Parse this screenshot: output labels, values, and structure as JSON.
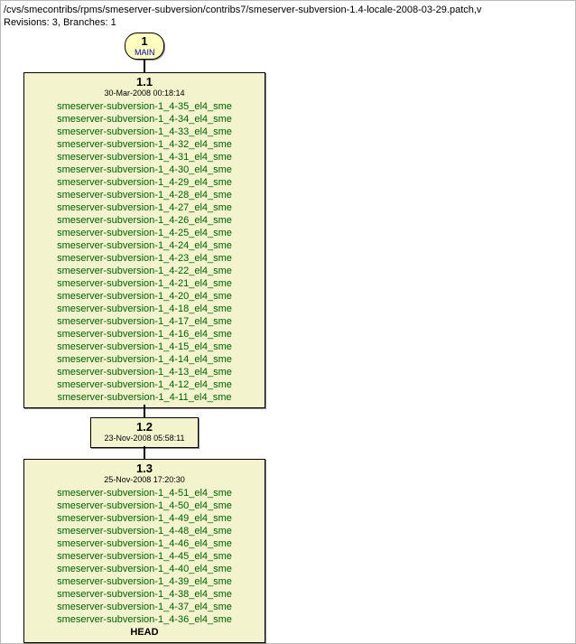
{
  "header": {
    "path": "/cvs/smecontribs/rpms/smeserver-subversion/contribs7/smeserver-subversion-1.4-locale-2008-03-29.patch,v",
    "meta": "Revisions: 3, Branches: 1"
  },
  "branch": {
    "num": "1",
    "name": "MAIN"
  },
  "nodes": [
    {
      "version": "1.1",
      "date": "30-Mar-2008 00:18:14",
      "tags": [
        "smeserver-subversion-1_4-35_el4_sme",
        "smeserver-subversion-1_4-34_el4_sme",
        "smeserver-subversion-1_4-33_el4_sme",
        "smeserver-subversion-1_4-32_el4_sme",
        "smeserver-subversion-1_4-31_el4_sme",
        "smeserver-subversion-1_4-30_el4_sme",
        "smeserver-subversion-1_4-29_el4_sme",
        "smeserver-subversion-1_4-28_el4_sme",
        "smeserver-subversion-1_4-27_el4_sme",
        "smeserver-subversion-1_4-26_el4_sme",
        "smeserver-subversion-1_4-25_el4_sme",
        "smeserver-subversion-1_4-24_el4_sme",
        "smeserver-subversion-1_4-23_el4_sme",
        "smeserver-subversion-1_4-22_el4_sme",
        "smeserver-subversion-1_4-21_el4_sme",
        "smeserver-subversion-1_4-20_el4_sme",
        "smeserver-subversion-1_4-18_el4_sme",
        "smeserver-subversion-1_4-17_el4_sme",
        "smeserver-subversion-1_4-16_el4_sme",
        "smeserver-subversion-1_4-15_el4_sme",
        "smeserver-subversion-1_4-14_el4_sme",
        "smeserver-subversion-1_4-13_el4_sme",
        "smeserver-subversion-1_4-12_el4_sme",
        "smeserver-subversion-1_4-11_el4_sme"
      ],
      "head": ""
    },
    {
      "version": "1.2",
      "date": "23-Nov-2008 05:58:11",
      "tags": [],
      "head": ""
    },
    {
      "version": "1.3",
      "date": "25-Nov-2008 17:20:30",
      "tags": [
        "smeserver-subversion-1_4-51_el4_sme",
        "smeserver-subversion-1_4-50_el4_sme",
        "smeserver-subversion-1_4-49_el4_sme",
        "smeserver-subversion-1_4-48_el4_sme",
        "smeserver-subversion-1_4-46_el4_sme",
        "smeserver-subversion-1_4-45_el4_sme",
        "smeserver-subversion-1_4-40_el4_sme",
        "smeserver-subversion-1_4-39_el4_sme",
        "smeserver-subversion-1_4-38_el4_sme",
        "smeserver-subversion-1_4-37_el4_sme",
        "smeserver-subversion-1_4-36_el4_sme"
      ],
      "head": "HEAD"
    }
  ]
}
